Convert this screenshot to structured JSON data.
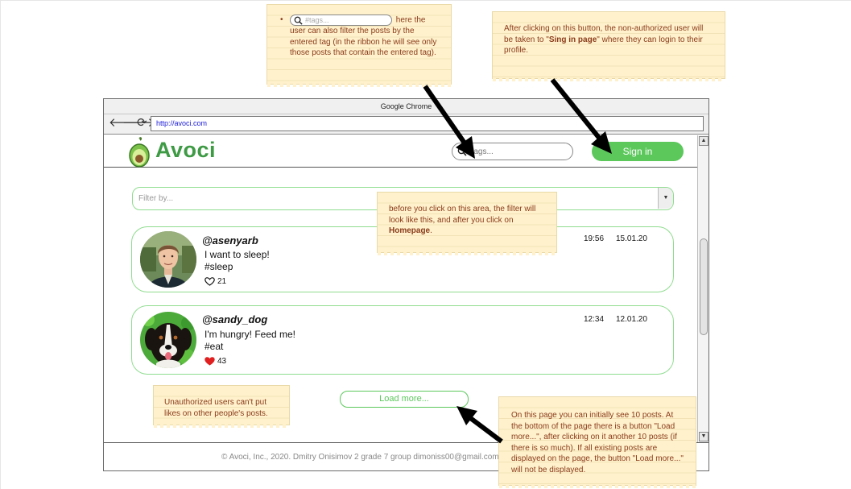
{
  "browser": {
    "title": "Google Chrome",
    "url": "http://avoci.com",
    "nav": {
      "back": "🡐",
      "forward": "🡒",
      "reload": "⟳"
    }
  },
  "site": {
    "brand": "Avoci",
    "tag_search_placeholder": "#tags...",
    "signin_label": "Sign in",
    "filter_placeholder": "Filter by...",
    "load_more_label": "Load more..."
  },
  "posts": [
    {
      "username": "@asenyarb",
      "text": "I want to sleep!",
      "tag": "#sleep",
      "time": "19:56",
      "date": "15.01.20",
      "likes": "21",
      "liked": false
    },
    {
      "username": "@sandy_dog",
      "text": "I'm hungry! Feed me!",
      "tag": "#eat",
      "time": "12:34",
      "date": "12.01.20",
      "likes": "43",
      "liked": true
    }
  ],
  "footer": {
    "text": "© Avoci, Inc., 2020.   Dmitry Onisimov  2 grade 7 group   dimoniss00@gmail.com"
  },
  "notes": {
    "tags": {
      "placeholder": "#tags...",
      "text": " here the user can also filter the posts by the entered tag (in the ribbon he will see only those posts that contain the entered tag)."
    },
    "signin": {
      "before": "After clicking on this button, the non-authorized user will be taken to \"",
      "bold": "Sing in page",
      "after": "\" where they can login to their profile."
    },
    "filter": {
      "before": "before you click on this area, the filter will look like this, and after you click on ",
      "bold": "Homepage",
      "after": "."
    },
    "likes": {
      "text": "Unauthorized users can't put likes on other people's posts."
    },
    "loadmore": {
      "text": "On this page you can initially see 10 posts. At the bottom of the page there is a button \"Load more...\", after clicking on it another 10 posts (if there is so much). If all existing posts are displayed on the page, the button \"Load more...\" will not be displayed."
    }
  },
  "colors": {
    "brand_green": "#3e9a44",
    "button_green": "#5cc85c",
    "outline_green": "#8fdc8f",
    "note_bg": "#fff1cc",
    "note_text": "#8a3b1a",
    "heart_red": "#e02020"
  }
}
